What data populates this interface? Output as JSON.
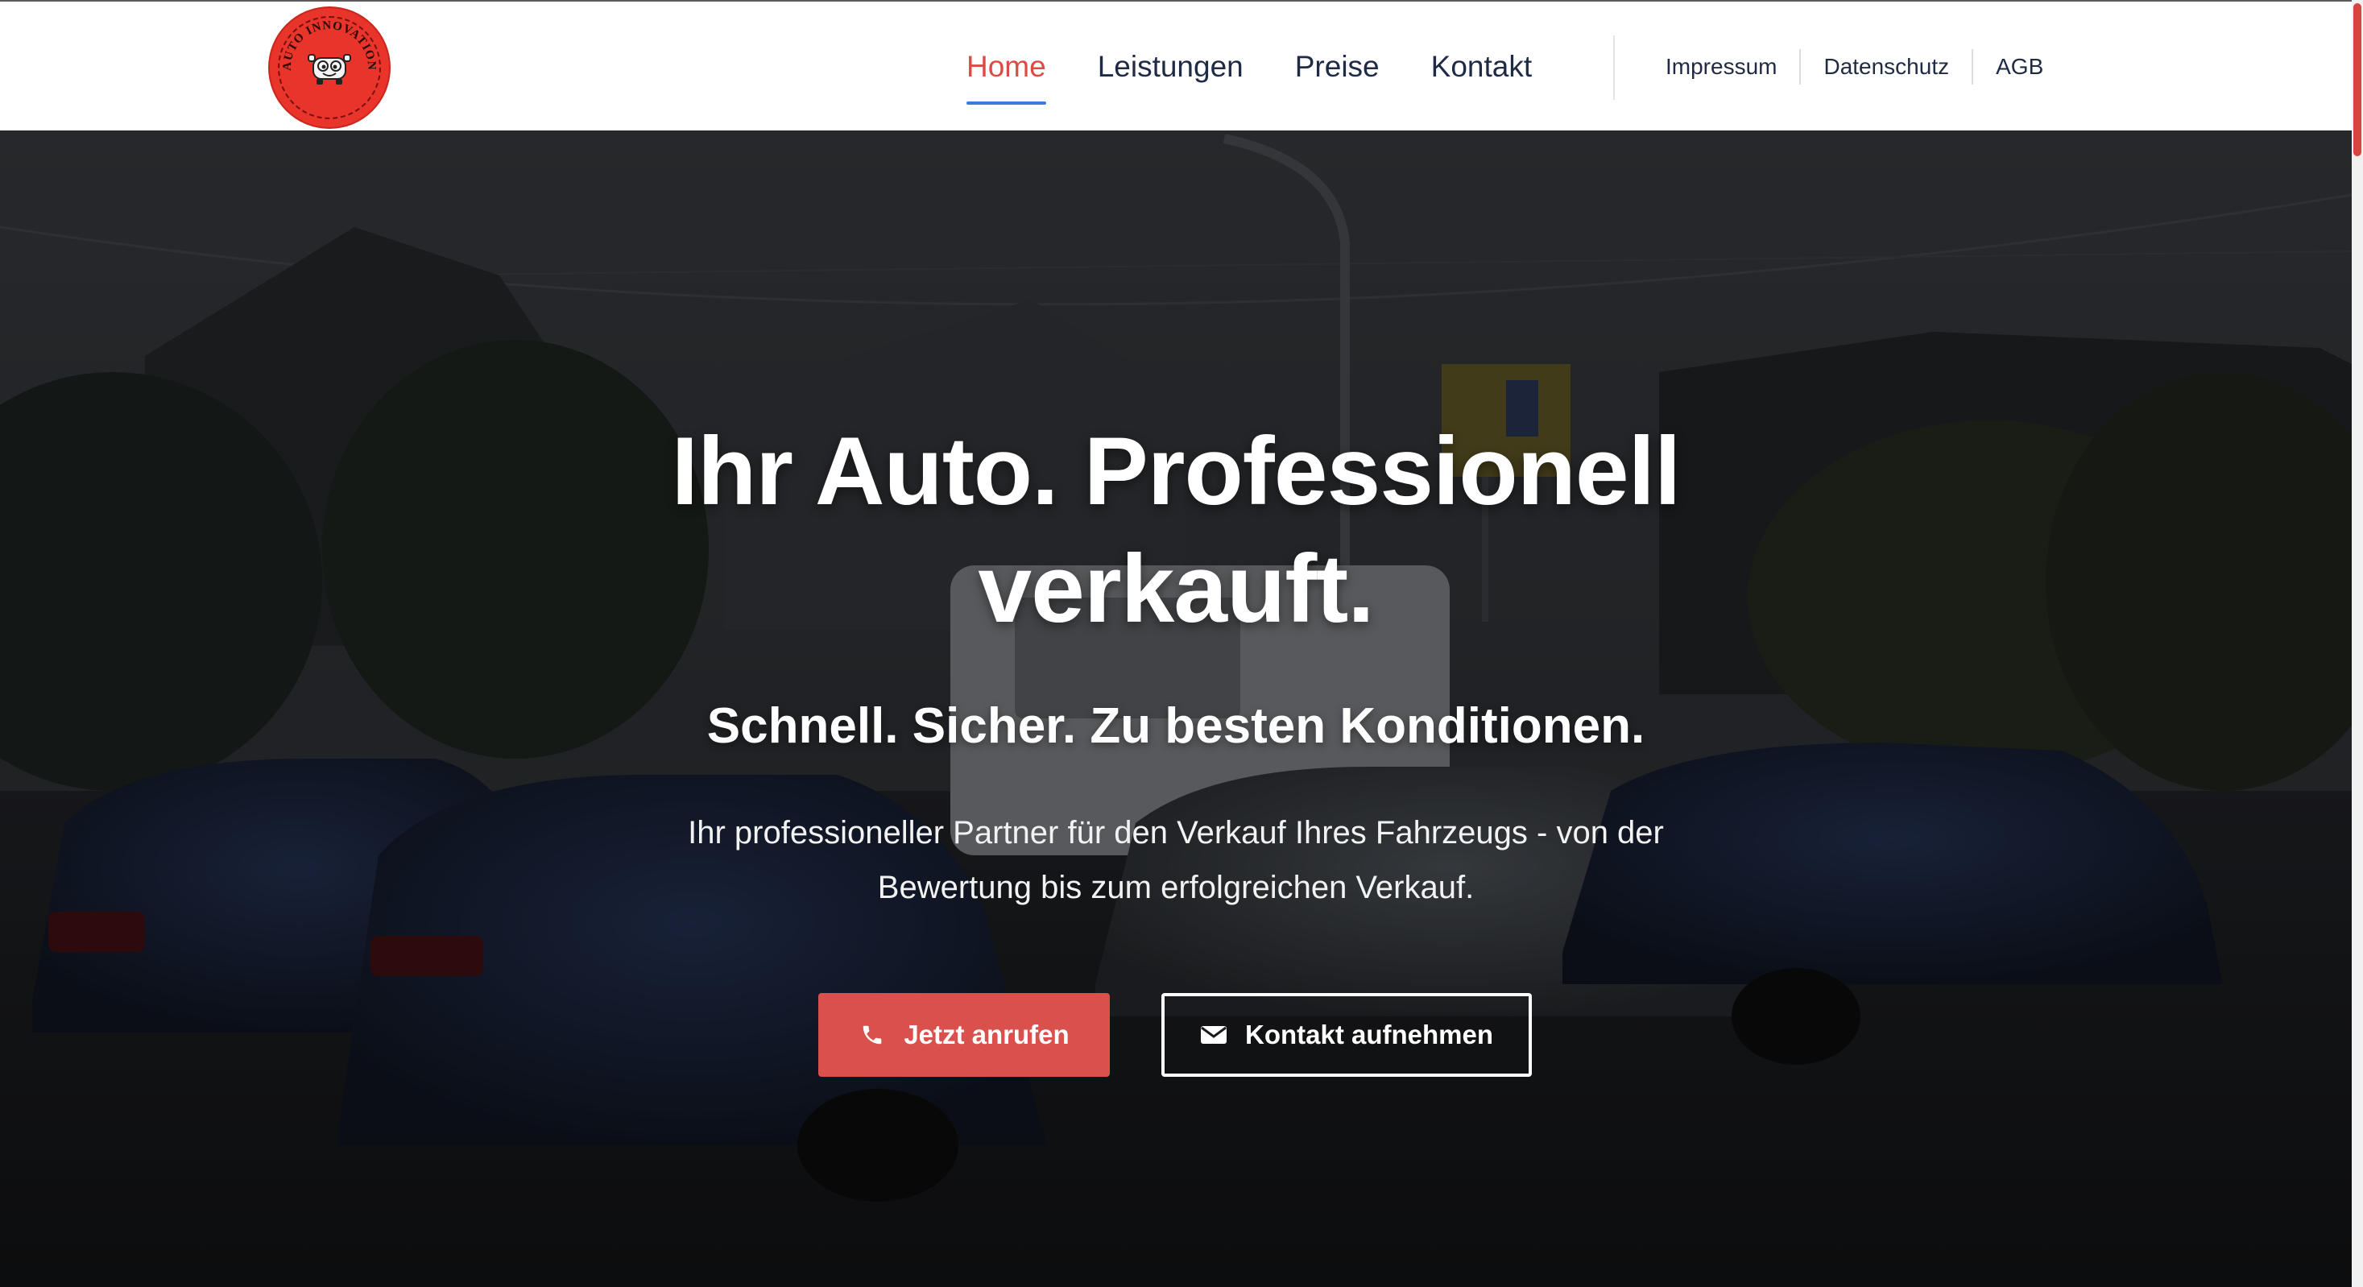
{
  "header": {
    "logo_text": "AUTO INNOVATION",
    "nav": [
      {
        "label": "Home",
        "active": true
      },
      {
        "label": "Leistungen",
        "active": false
      },
      {
        "label": "Preise",
        "active": false
      },
      {
        "label": "Kontakt",
        "active": false
      }
    ],
    "legal": [
      {
        "label": "Impressum"
      },
      {
        "label": "Datenschutz"
      },
      {
        "label": "AGB"
      }
    ]
  },
  "hero": {
    "title_line1": "Ihr Auto. Professionell",
    "title_line2": "verkauft.",
    "subtitle": "Schnell. Sicher. Zu besten Konditionen.",
    "text": "Ihr professioneller Partner für den Verkauf Ihres Fahrzeugs - von der Bewertung bis zum erfolgreichen Verkauf.",
    "buttons": {
      "call": {
        "label": "Jetzt anrufen",
        "icon": "phone-icon"
      },
      "contact": {
        "label": "Kontakt aufnehmen",
        "icon": "envelope-icon"
      }
    }
  },
  "colors": {
    "accent": "#dd4b45",
    "nav_text": "#1f2a44",
    "active_underline": "#3d7be0",
    "call_button": "#d9504d"
  }
}
